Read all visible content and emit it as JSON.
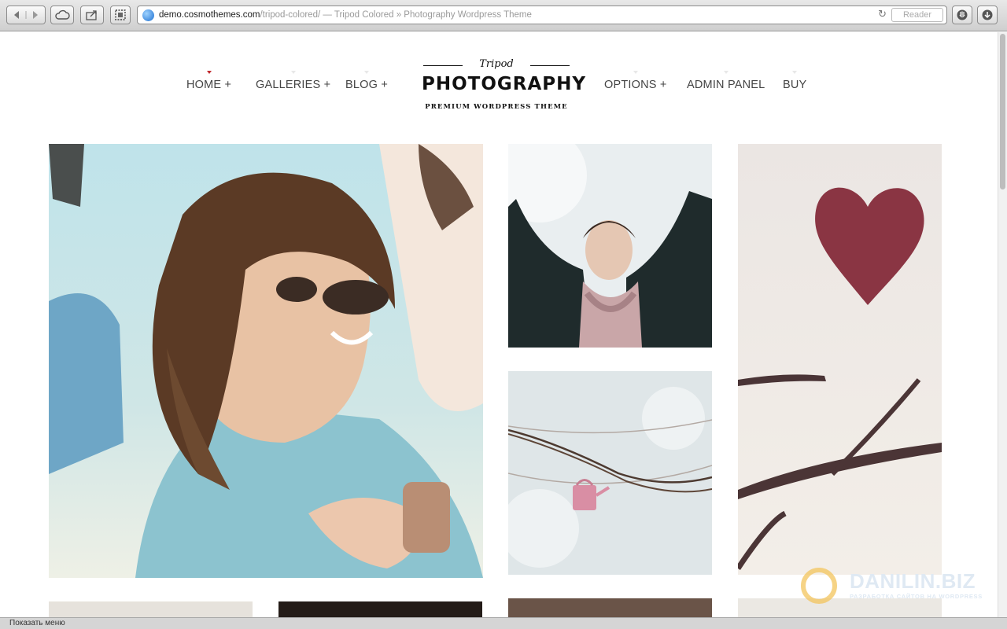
{
  "browser": {
    "url_domain": "demo.cosmothemes.com",
    "url_path": "/tripod-colored/",
    "page_title": " — Tripod Colored » Photography Wordpress Theme",
    "reader_label": "Reader",
    "reload_glyph": "↻",
    "icons": [
      "back-arrow-icon",
      "forward-arrow-icon",
      "cloud-icon",
      "share-icon",
      "screenshot-icon",
      "globe-icon",
      "reload-icon",
      "adblock-icon",
      "download-icon"
    ]
  },
  "nav": {
    "left": [
      {
        "label": "HOME +",
        "active": true
      },
      {
        "label": "GALLERIES +",
        "active": false
      },
      {
        "label": "BLOG +",
        "active": false
      }
    ],
    "right": [
      {
        "label": "OPTIONS +",
        "active": false
      },
      {
        "label": "ADMIN PANEL",
        "active": false
      },
      {
        "label": "BUY",
        "active": false
      }
    ],
    "active_color": "#c0282c"
  },
  "logo": {
    "script": "Tripod",
    "main": "PHOTOGRAPHY",
    "subtitle": "PREMIUM WORDPRESS THEME"
  },
  "gallery": {
    "photos": [
      {
        "subject": "laughing woman with sunglasses"
      },
      {
        "subject": "girl with raised arms in snow"
      },
      {
        "subject": "red heart on branch"
      },
      {
        "subject": "pink watering can on string"
      },
      {
        "subject": "partial photo bottom row 1"
      },
      {
        "subject": "partial photo bottom row 2"
      },
      {
        "subject": "partial photo bottom row 3"
      },
      {
        "subject": "partial photo bottom row 4"
      }
    ]
  },
  "watermark": {
    "brand": "DANILIN.BIZ",
    "tagline": "РАЗРАБОТКА САЙТОВ НА WORDPRESS"
  },
  "status_bar": {
    "text": "Показать меню"
  }
}
